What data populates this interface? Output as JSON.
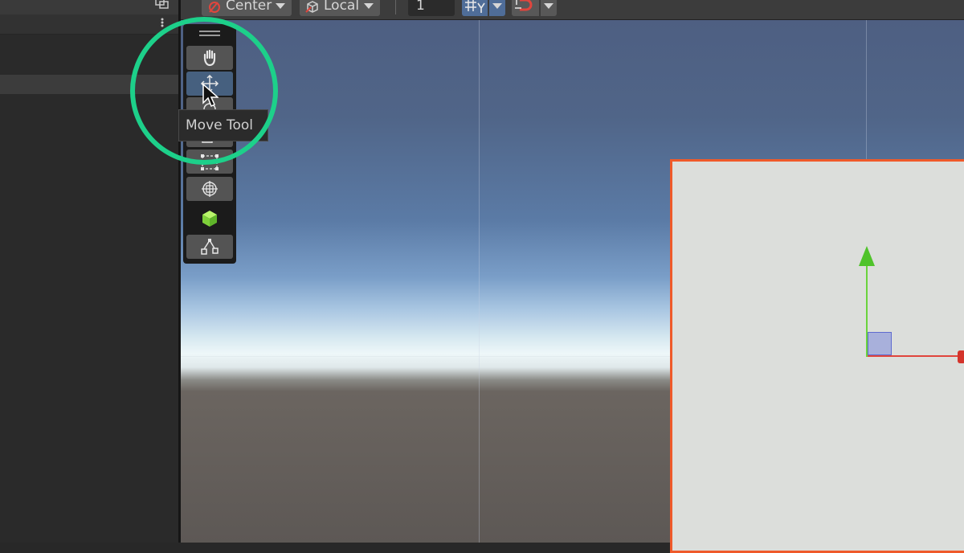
{
  "toolbar": {
    "pivot_mode": "Center",
    "pivot_rotation": "Local",
    "grid_size": "1"
  },
  "tools_overlay": {
    "items": [
      {
        "name": "hand-tool",
        "icon": "hand-icon"
      },
      {
        "name": "move-tool",
        "icon": "move-icon",
        "selected": true
      },
      {
        "name": "rotate-tool",
        "icon": "rotate-icon"
      },
      {
        "name": "scale-tool",
        "icon": "scale-icon"
      },
      {
        "name": "rect-tool",
        "icon": "rect-icon"
      },
      {
        "name": "transform-tool",
        "icon": "transform-icon"
      },
      {
        "name": "custom-tool",
        "icon": "cube-icon"
      },
      {
        "name": "custom-editor-tool",
        "icon": "nodes-icon"
      }
    ],
    "tooltip": "Move Tool"
  },
  "colors": {
    "highlight": "#1dd08a",
    "selection_outline": "#ef5a2a",
    "x_axis": "#e0453d",
    "y_axis": "#4fc32a",
    "active_tool": "#46607f"
  }
}
